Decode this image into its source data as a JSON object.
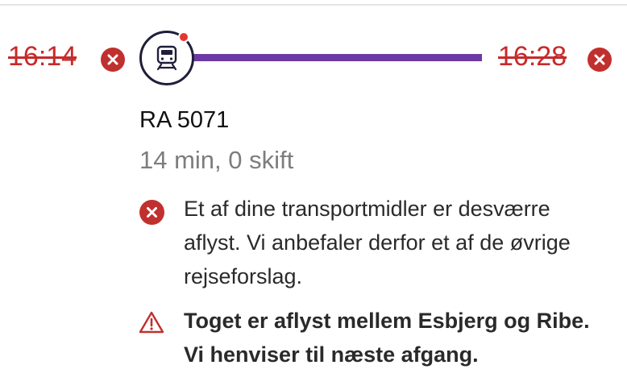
{
  "journey": {
    "departure_time": "16:14",
    "arrival_time": "16:28",
    "train_id": "RA 5071",
    "duration": "14 min, 0 skift",
    "status": "cancelled",
    "transport_icon": "train-icon"
  },
  "messages": [
    {
      "icon": "cancel-circle-icon",
      "text": "Et af dine transportmidler er desværre aflyst. Vi anbefaler derfor et af de øvrige rejseforslag."
    },
    {
      "icon": "warning-triangle-icon",
      "text": "Toget er aflyst mellem Esbjerg og Ribe. Vi henviser til næste afgang."
    }
  ],
  "colors": {
    "cancel_red": "#c0302e",
    "route_purple": "#6c3aa4",
    "alert_dot": "#e8342f",
    "muted_text": "#7d7d80"
  }
}
